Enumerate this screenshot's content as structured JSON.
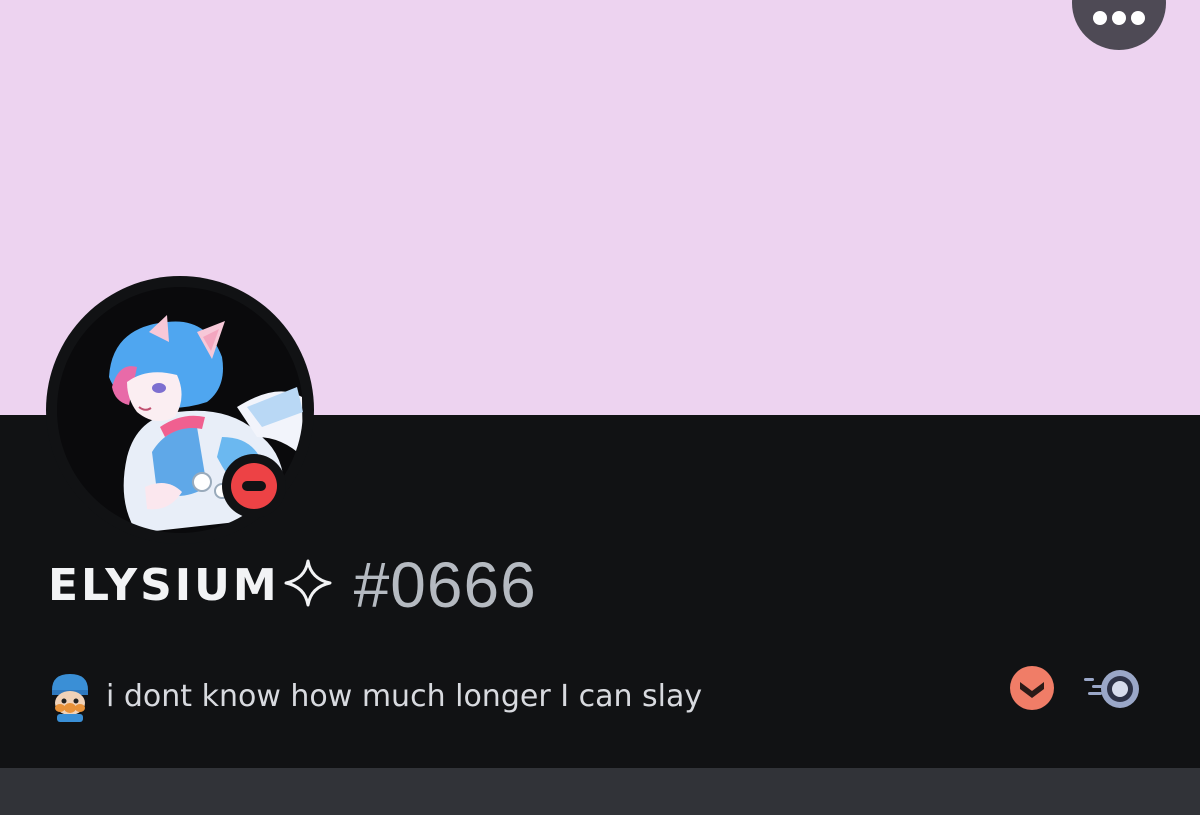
{
  "profile": {
    "username": "ELYSIUM",
    "discriminator": "#0666",
    "custom_status": "i dont know how much longer I can slay",
    "status": "do-not-disturb"
  },
  "colors": {
    "banner": "#edd3f0",
    "body": "#111214",
    "strip": "#313338",
    "dnd": "#ed4245"
  },
  "icons": {
    "menu": "more-options-icon",
    "name_decoration": "sparkle-icon",
    "status_emoji": "pocoyo-emoji-icon",
    "badges": [
      "hypesquad-brilliance-badge-icon",
      "nitro-badge-icon"
    ]
  }
}
